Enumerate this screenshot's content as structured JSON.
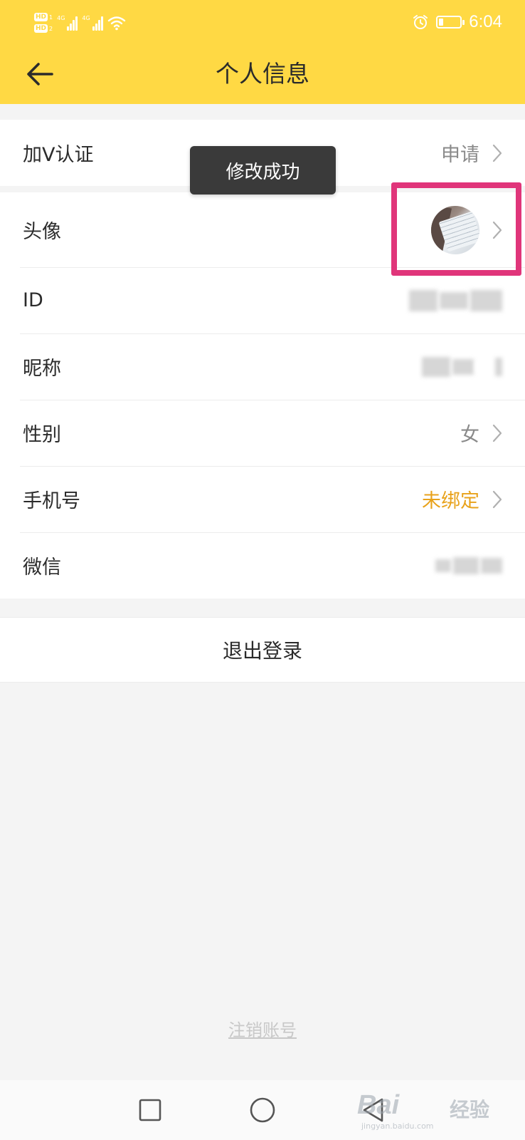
{
  "status_bar": {
    "hd_labels": [
      "HD",
      "HD"
    ],
    "sim_numbers": [
      "1",
      "2"
    ],
    "network_tags": [
      "4G",
      "4G"
    ],
    "time": "6:04",
    "battery_level": 0.2,
    "icons": [
      "hd-icon",
      "signal-icon",
      "wifi-icon",
      "alarm-icon",
      "battery-icon"
    ]
  },
  "header": {
    "title": "个人信息",
    "back_icon": "arrow-left-icon"
  },
  "toast": {
    "message": "修改成功"
  },
  "section_verify": {
    "rows": [
      {
        "label": "加V认证",
        "value": "申请",
        "has_chevron": true
      }
    ]
  },
  "section_profile": {
    "rows": [
      {
        "label": "头像",
        "value_type": "avatar",
        "has_chevron": true
      },
      {
        "label": "ID",
        "value_type": "blurred",
        "has_chevron": false
      },
      {
        "label": "昵称",
        "value_type": "blurred",
        "has_chevron": false
      },
      {
        "label": "性别",
        "value": "女",
        "has_chevron": true
      },
      {
        "label": "手机号",
        "value": "未绑定",
        "value_color": "#e8a21b",
        "has_chevron": true
      },
      {
        "label": "微信",
        "value_type": "blurred",
        "has_chevron": false
      }
    ]
  },
  "logout": {
    "label": "退出登录"
  },
  "cancel_account": {
    "label": "注销账号"
  },
  "system_nav": {
    "icons": [
      "square-recents-icon",
      "circle-home-icon",
      "triangle-back-icon"
    ]
  },
  "watermark": {
    "brand": "Bai",
    "suffix": "经验",
    "url": "jingyan.baidu.com"
  },
  "colors": {
    "accent_yellow": "#ffd944",
    "highlight_pink": "#e0357a",
    "warning_orange": "#e8a21b"
  }
}
